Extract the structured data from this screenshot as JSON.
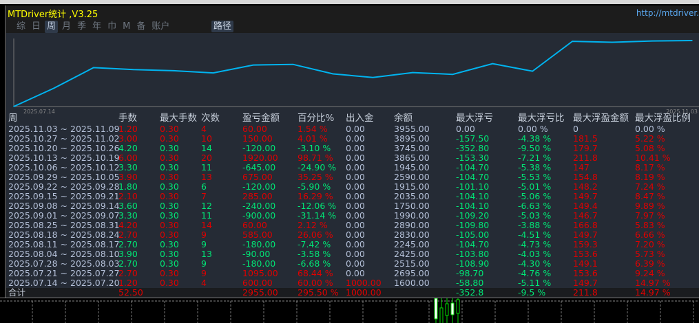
{
  "window": {
    "title": "MTDriver统计 ,V3.25",
    "url": "http://mtdriver."
  },
  "tabs": [
    {
      "label": "综",
      "active": false
    },
    {
      "label": "日",
      "active": false
    },
    {
      "label": "周",
      "active": true
    },
    {
      "label": "月",
      "active": false
    },
    {
      "label": "季",
      "active": false
    },
    {
      "label": "年",
      "active": false
    },
    {
      "label": "巾",
      "active": false
    },
    {
      "label": "M",
      "active": false
    },
    {
      "label": "备",
      "active": false
    },
    {
      "label": "账户",
      "active": false
    }
  ],
  "route_tab": "路径",
  "colors": {
    "line": "#00b4f0",
    "profit": "#e00000",
    "loss": "#00e676",
    "text": "#b4c0d8",
    "panel": "#252b35"
  },
  "chart_data": {
    "type": "line",
    "x_start_label": "2025.07.14",
    "x_end_label": "2025.11.03",
    "values": [
      0,
      60,
      128.44,
      121.76,
      118.18,
      110.76,
      136.82,
      138.94,
      107.8,
      95.74,
      112.03,
      106.13,
      141.38,
      116.48,
      215.19,
      212.09,
      216.1,
      217.64
    ]
  },
  "table": {
    "headers": [
      "周",
      "手数",
      "最大手数",
      "次数",
      "盈亏金额",
      "百分比%",
      "出入金",
      "余额",
      "最大浮亏",
      "最大浮亏比",
      "最大浮盈金额",
      "最大浮盈比例"
    ],
    "rows": [
      [
        "2025.11.03 ~ 2025.11.09",
        "1.20",
        "0.30",
        "4",
        "60.00",
        "1.54 %",
        "0.00",
        "3955.00",
        "0.00",
        "0.00 %",
        "0",
        "0.00 %"
      ],
      [
        "2025.10.27 ~ 2025.11.02",
        "3.00",
        "0.30",
        "10",
        "150.00",
        "4.01 %",
        "0.00",
        "3895.00",
        "-157.50",
        "-4.38 %",
        "181.5",
        "5.22 %"
      ],
      [
        "2025.10.20 ~ 2025.10.26",
        "4.20",
        "0.30",
        "14",
        "-120.00",
        "-3.10 %",
        "0.00",
        "3745.00",
        "-352.80",
        "-9.50 %",
        "179.7",
        "5.08 %"
      ],
      [
        "2025.10.13 ~ 2025.10.19",
        "6.00",
        "0.30",
        "20",
        "1920.00",
        "98.71 %",
        "0.00",
        "3865.00",
        "-153.30",
        "-7.21 %",
        "211.8",
        "10.41 %"
      ],
      [
        "2025.10.06 ~ 2025.10.12",
        "3.30",
        "0.30",
        "11",
        "-645.00",
        "-24.90 %",
        "0.00",
        "1945.00",
        "-104.70",
        "-5.38 %",
        "147",
        "8.17 %"
      ],
      [
        "2025.09.29 ~ 2025.10.05",
        "3.90",
        "0.30",
        "13",
        "675.00",
        "35.25 %",
        "0.00",
        "2590.00",
        "-104.70",
        "-5.53 %",
        "154.8",
        "8.19 %"
      ],
      [
        "2025.09.22 ~ 2025.09.28",
        "1.80",
        "0.30",
        "6",
        "-120.00",
        "-5.90 %",
        "0.00",
        "1915.00",
        "-101.10",
        "-5.01 %",
        "148.2",
        "7.24 %"
      ],
      [
        "2025.09.15 ~ 2025.09.21",
        "2.10",
        "0.30",
        "7",
        "285.00",
        "16.29 %",
        "0.00",
        "2035.00",
        "-104.10",
        "-5.06 %",
        "149.7",
        "8.47 %"
      ],
      [
        "2025.09.08 ~ 2025.09.14",
        "3.60",
        "0.30",
        "12",
        "-240.00",
        "-12.06 %",
        "0.00",
        "1750.00",
        "-104.10",
        "-6.63 %",
        "149.4",
        "9.89 %"
      ],
      [
        "2025.09.01 ~ 2025.09.07",
        "3.30",
        "0.30",
        "11",
        "-900.00",
        "-31.14 %",
        "0.00",
        "1990.00",
        "-109.20",
        "-5.03 %",
        "146.7",
        "7.97 %"
      ],
      [
        "2025.08.25 ~ 2025.08.31",
        "4.20",
        "0.30",
        "14",
        "60.00",
        "2.12 %",
        "0.00",
        "2890.00",
        "-109.80",
        "-3.88 %",
        "166.8",
        "5.83 %"
      ],
      [
        "2025.08.18 ~ 2025.08.24",
        "2.70",
        "0.30",
        "9",
        "585.00",
        "26.06 %",
        "0.00",
        "2830.00",
        "-105.00",
        "-4.51 %",
        "149.7",
        "6.66 %"
      ],
      [
        "2025.08.11 ~ 2025.08.17",
        "2.70",
        "0.30",
        "9",
        "-180.00",
        "-7.42 %",
        "0.00",
        "2245.00",
        "-104.70",
        "-4.73 %",
        "159.3",
        "7.20 %"
      ],
      [
        "2025.08.04 ~ 2025.08.10",
        "3.90",
        "0.30",
        "13",
        "-90.00",
        "-3.58 %",
        "0.00",
        "2425.00",
        "-103.80",
        "-4.03 %",
        "153.6",
        "5.73 %"
      ],
      [
        "2025.07.28 ~ 2025.08.03",
        "2.70",
        "0.30",
        "9",
        "-180.00",
        "-6.68 %",
        "0.00",
        "2515.00",
        "-108.90",
        "-4.30 %",
        "149.1",
        "6.39 %"
      ],
      [
        "2025.07.21 ~ 2025.07.27",
        "2.70",
        "0.30",
        "9",
        "1095.00",
        "68.44 %",
        "0.00",
        "2695.00",
        "-98.70",
        "-4.76 %",
        "153.6",
        "9.24 %"
      ],
      [
        "2025.07.14 ~ 2025.07.20",
        "1.20",
        "0.30",
        "4",
        "600.00",
        "60.00 %",
        "1000.00",
        "1600.00",
        "-58.80",
        "-5.11 %",
        "149.7",
        "14.97 %"
      ]
    ],
    "total": [
      "合计",
      "52.50",
      "",
      "",
      "2955.00",
      "295.50 %",
      "1000.00",
      "",
      "-352.8",
      "-9.5 %",
      "211.8",
      "14.97 %"
    ]
  }
}
